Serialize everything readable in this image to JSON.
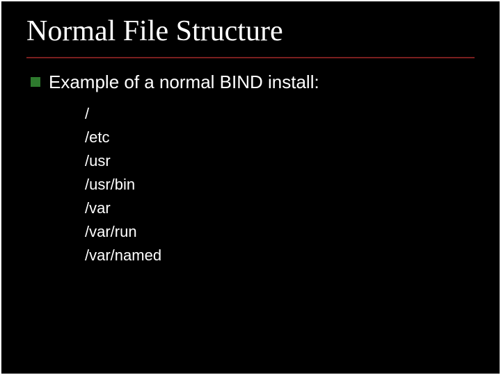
{
  "title": "Normal File Structure",
  "point": "Example of a normal BIND install:",
  "paths": {
    "p0": "/",
    "p1": "/etc",
    "p2": "/usr",
    "p3": "/usr/bin",
    "p4": "/var",
    "p5": "/var/run",
    "p6": "/var/named"
  },
  "colors": {
    "background": "#000000",
    "text": "#ffffff",
    "rule": "#7a1f1f",
    "bullet": "#2e7a2e"
  }
}
